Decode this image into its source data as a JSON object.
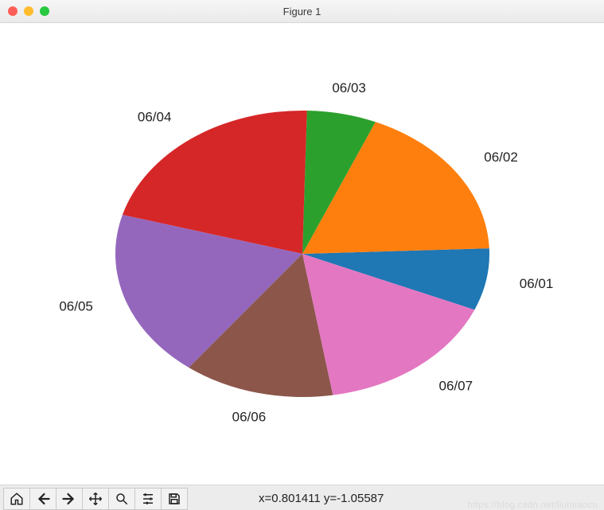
{
  "window": {
    "title": "Figure 1"
  },
  "status": {
    "text": "x=0.801411    y=-1.05587"
  },
  "watermark": "https://blog.csdn.net/liumiaocn",
  "toolbar_buttons": {
    "home": "home-icon",
    "back": "left-arrow-icon",
    "forward": "right-arrow-icon",
    "pan": "move-icon",
    "zoom": "magnifier-icon",
    "configure": "sliders-icon",
    "save": "save-icon"
  },
  "chart_data": {
    "type": "pie",
    "title": "",
    "start_angle_deg": -23,
    "direction": "counterclockwise",
    "slices": [
      {
        "label": "06/01",
        "value": 7,
        "color": "#1f77b4"
      },
      {
        "label": "06/02",
        "value": 18,
        "color": "#ff7f0e"
      },
      {
        "label": "06/03",
        "value": 6,
        "color": "#2ca02c"
      },
      {
        "label": "06/04",
        "value": 21,
        "color": "#d62728"
      },
      {
        "label": "06/05",
        "value": 19,
        "color": "#9467bd"
      },
      {
        "label": "06/06",
        "value": 13,
        "color": "#8c564b"
      },
      {
        "label": "06/07",
        "value": 16,
        "color": "#e377c2"
      }
    ]
  }
}
